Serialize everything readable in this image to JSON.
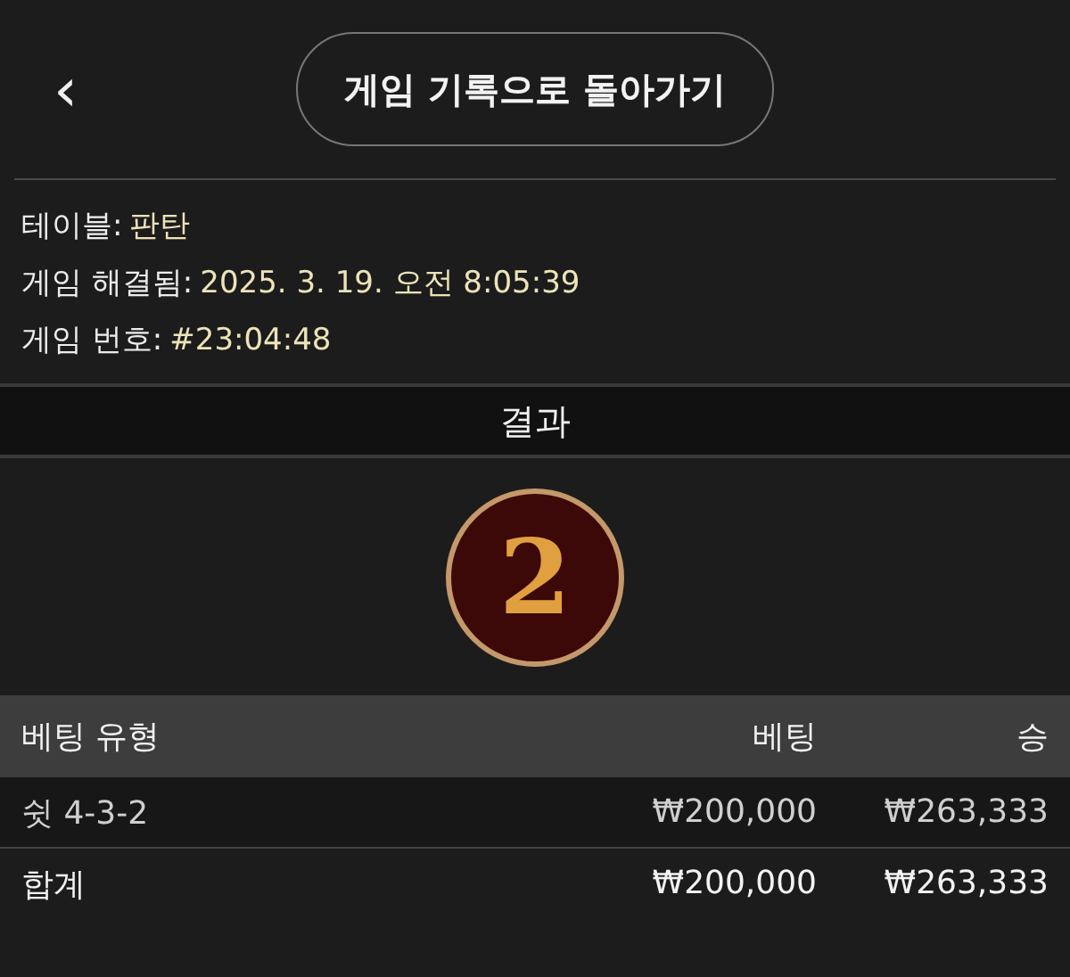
{
  "header": {
    "back_icon": "‹",
    "button": "게임 기록으로 돌아가기"
  },
  "info": [
    {
      "label": "테이블:",
      "value": "판탄"
    },
    {
      "label": "게임 해결됨:",
      "value": "2025. 3. 19. 오전 8:05:39"
    },
    {
      "label": "게임 번호:",
      "value": "#23:04:48"
    }
  ],
  "result": {
    "title": "결과",
    "number": "2"
  },
  "table": {
    "columns": [
      "베팅 유형",
      "베팅",
      "승"
    ],
    "rows": [
      {
        "kind": "bet",
        "cells": [
          "쉿 4-3-2",
          "₩200,000",
          "₩263,333"
        ]
      },
      {
        "kind": "total",
        "cells": [
          "합계",
          "₩200,000",
          "₩263,333"
        ]
      }
    ]
  }
}
